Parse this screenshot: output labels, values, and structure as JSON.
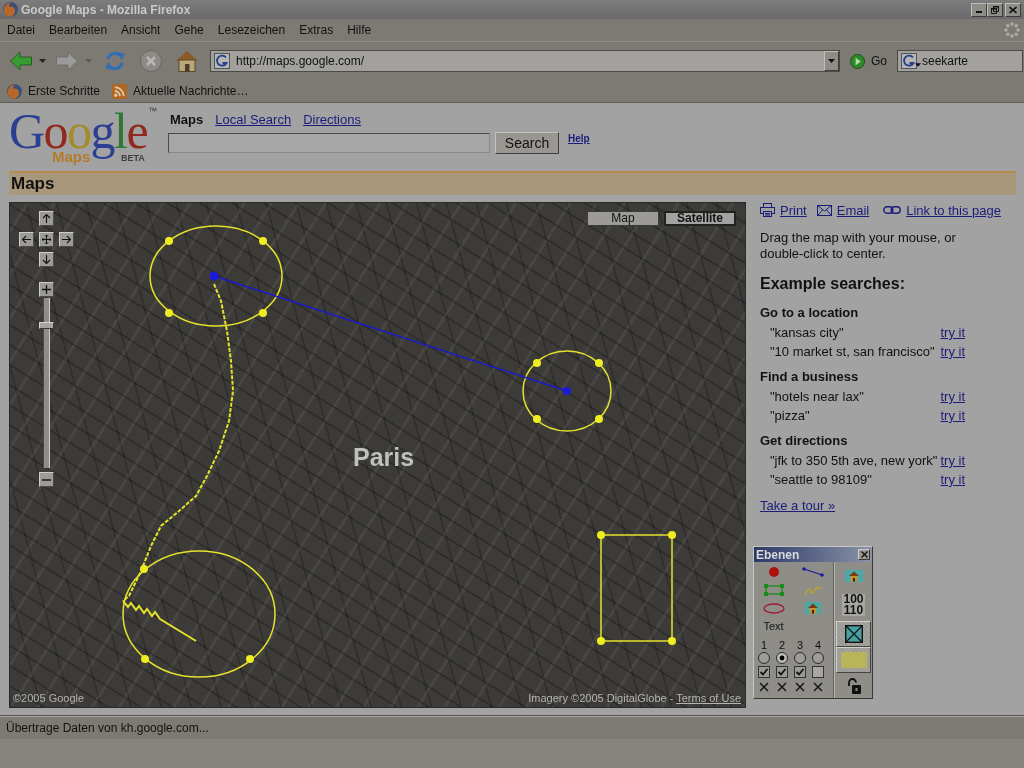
{
  "window": {
    "title": "Google Maps - Mozilla Firefox"
  },
  "menu": [
    "Datei",
    "Bearbeiten",
    "Ansicht",
    "Gehe",
    "Lesezeichen",
    "Extras",
    "Hilfe"
  ],
  "toolbar": {
    "buttons": [
      {
        "kind": "back",
        "disabled": false,
        "dropdown": true
      },
      {
        "kind": "forward",
        "disabled": true,
        "dropdown": true
      },
      {
        "kind": "reload",
        "disabled": false,
        "dropdown": false
      },
      {
        "kind": "stop",
        "disabled": true,
        "dropdown": false
      },
      {
        "kind": "home",
        "disabled": false,
        "dropdown": false
      }
    ],
    "url": "http://maps.google.com/",
    "go": "Go",
    "search": "seekarte"
  },
  "bookmarks": [
    {
      "kind": "page",
      "label": "Erste Schritte"
    },
    {
      "kind": "feed",
      "label": "Aktuelle Nachrichte…"
    }
  ],
  "page": {
    "logo": {
      "letters": [
        {
          "char": "G",
          "color": "#2b3f92"
        },
        {
          "char": "o",
          "color": "#902a1e"
        },
        {
          "char": "o",
          "color": "#a48b2a"
        },
        {
          "char": "g",
          "color": "#2b3f92"
        },
        {
          "char": "l",
          "color": "#2f7a32"
        },
        {
          "char": "e",
          "color": "#902a1e"
        }
      ],
      "mark": "™",
      "product": "Maps",
      "badge": "BETA"
    },
    "tabs": [
      {
        "label": "Maps",
        "selected": true
      },
      {
        "label": "Local Search",
        "selected": false
      },
      {
        "label": "Directions",
        "selected": false
      }
    ],
    "search": {
      "button": "Search",
      "help": "Help"
    },
    "section_title": "Maps",
    "map": {
      "modes": [
        {
          "label": "Map",
          "selected": false
        },
        {
          "label": "Satellite",
          "selected": true
        }
      ],
      "zoom": {
        "level": 0.85
      },
      "label": "Paris",
      "copyright": "©2005 Google",
      "imagery": "Imagery ©2005 DigitalGlobe -",
      "terms": "Terms of Use"
    },
    "sidebar": {
      "actions": [
        {
          "kind": "print",
          "label": "Print"
        },
        {
          "kind": "email",
          "label": "Email"
        },
        {
          "kind": "link",
          "label": "Link to this page"
        }
      ],
      "hint": "Drag the map with your mouse, or double-click to center.",
      "examples_title": "Example searches:",
      "groups": [
        {
          "title": "Go to a location",
          "items": [
            {
              "query": "\"kansas city\"",
              "action": "try it"
            },
            {
              "query": "\"10 market st, san francisco\"",
              "action": "try it"
            }
          ]
        },
        {
          "title": "Find a business",
          "items": [
            {
              "query": "\"hotels near lax\"",
              "action": "try it"
            },
            {
              "query": "\"pizza\"",
              "action": "try it"
            }
          ]
        },
        {
          "title": "Get directions",
          "items": [
            {
              "query": "\"jfk to 350 5th ave, new york\"",
              "action": "try it"
            },
            {
              "query": "\"seattle to 98109\"",
              "action": "try it"
            }
          ]
        }
      ],
      "tour": "Take a tour »"
    },
    "layers_panel": {
      "title": "Ebenen",
      "tools": [
        {
          "kind": "dot"
        },
        {
          "kind": "line"
        },
        {
          "kind": "rect"
        },
        {
          "kind": "squiggle"
        },
        {
          "kind": "ellipse"
        },
        {
          "kind": "house"
        },
        {
          "kind": "text",
          "label": "Text"
        }
      ],
      "layers": [
        {
          "number": "1",
          "selected": false,
          "visible": true
        },
        {
          "number": "2",
          "selected": true,
          "visible": true
        },
        {
          "number": "3",
          "selected": false,
          "visible": true
        },
        {
          "number": "4",
          "selected": false,
          "visible": false
        }
      ],
      "buttons": [
        {
          "kind": "house",
          "selected": false
        },
        {
          "kind": "binary",
          "lines": [
            "100",
            "110"
          ],
          "selected": false
        },
        {
          "kind": "crossbox",
          "selected": true
        },
        {
          "kind": "swatch",
          "selected": true
        },
        {
          "kind": "lock",
          "selected": false
        }
      ]
    }
  },
  "status_bar": {
    "text": "Übertrage Daten von kh.google.com..."
  }
}
